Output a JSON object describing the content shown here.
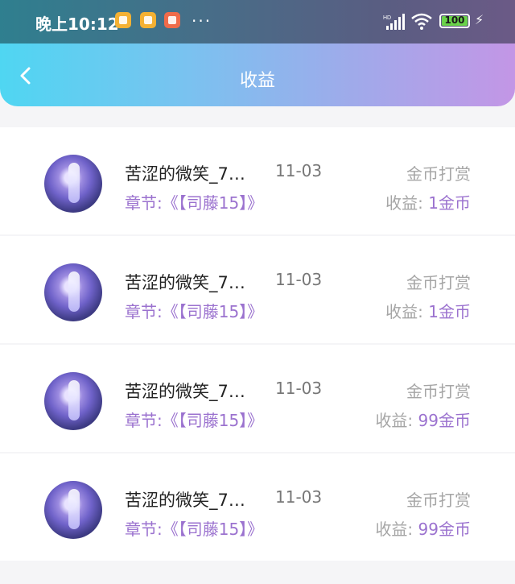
{
  "status_bar": {
    "time": "晚上10:12",
    "more": "···",
    "battery_level": "100",
    "icons": [
      "app-icon-1",
      "app-icon-2",
      "app-icon-3",
      "signal-hd-icon",
      "wifi-icon",
      "battery-icon",
      "charging-icon"
    ]
  },
  "header": {
    "title": "收益",
    "back_icon": "chevron-left-icon"
  },
  "colors": {
    "accent": "#9b72cf",
    "header_gradient_start": "#4fd6f2",
    "header_gradient_end": "#c396e6"
  },
  "records": [
    {
      "name": "苦涩的微笑_7…",
      "date": "11-03",
      "chapter": "章节:《【司藤15】》",
      "type": "金币打赏",
      "earn_label": "收益:",
      "earn_amount": "1金币"
    },
    {
      "name": "苦涩的微笑_7…",
      "date": "11-03",
      "chapter": "章节:《【司藤15】》",
      "type": "金币打赏",
      "earn_label": "收益:",
      "earn_amount": "1金币"
    },
    {
      "name": "苦涩的微笑_7…",
      "date": "11-03",
      "chapter": "章节:《【司藤15】》",
      "type": "金币打赏",
      "earn_label": "收益:",
      "earn_amount": "99金币"
    },
    {
      "name": "苦涩的微笑_7…",
      "date": "11-03",
      "chapter": "章节:《【司藤15】》",
      "type": "金币打赏",
      "earn_label": "收益:",
      "earn_amount": "99金币"
    }
  ]
}
